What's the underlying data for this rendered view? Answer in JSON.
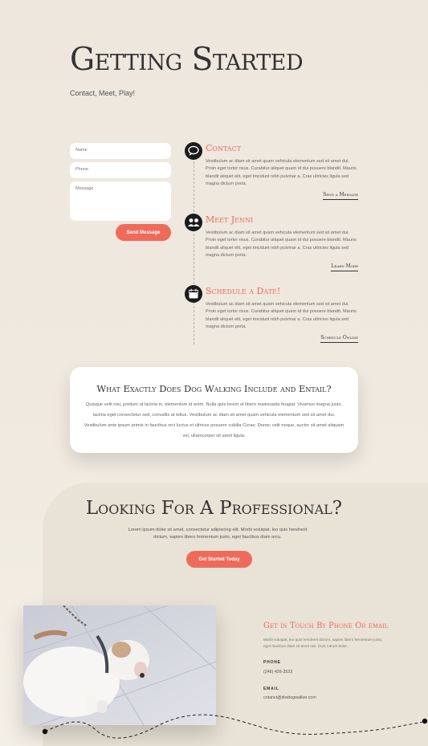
{
  "header": {
    "title": "Getting Started",
    "subtitle": "Contact, Meet, Play!"
  },
  "form": {
    "name_placeholder": "Name",
    "phone_placeholder": "Phone",
    "message_placeholder": "Message",
    "send_label": "Send Message"
  },
  "timeline": [
    {
      "title": "Contact",
      "icon": "chat-bubble-icon",
      "body": "Vestibulum ac diam sit amet quam vehicula elementum sed sit amet dui. Proin eget tortor risus. Curabitur aliquet quam id dui posuere blandit. Mauris blandit aliquet elit, eget tincidunt nibh pulvinar a. Cras ultricies ligula sed magna dictum porta.",
      "link": "Send a Message"
    },
    {
      "title": "Meet Jenni",
      "icon": "people-icon",
      "body": "Vestibulum ac diam sit amet quam vehicula elementum sed sit amet dui. Proin eget tortor risus. Curabitur aliquet quam id dui posuere blandit. Mauris blandit aliquet elit, eget tincidunt nibh pulvinar a. Cras ultricies ligula sed magna dictum porta.",
      "link": "Learn More"
    },
    {
      "title": "Schedule a Date!",
      "icon": "calendar-icon",
      "body": "Vestibulum ac diam sit amet quam vehicula elementum sed sit amet dui. Proin eget tortor risus. Curabitur aliquet quam id dui posuere blandit. Mauris blandit aliquet elit, eget tincidunt nibh pulvinar a. Cras ultricies ligula sed magna dictum porta.",
      "link": "Schedule Online"
    }
  ],
  "card": {
    "title": "What Exactly Does Dog Walking Include and Entail?",
    "body": "Quisque velit nisi, pretium ut lacinia in, elementum id enim. Nulla quis lorem ut libero malesuada feugiat. Vivamus magna justo, lacinia eget consectetur sed, convallis at tellus. Vestibulum ac diam sit amet quam vehicula elementum sed sit amet dui. Vestibulum ante ipsum primis in faucibus orci luctus et ultrices posuere cubilia Curae; Donec velit neque, auctor sit amet aliquam vel, ullamcorper sit amet ligula."
  },
  "professional": {
    "title": "Looking For A Professional?",
    "body": "Lorem ipsum dolor sit amet, consectetur adipiscing elit. Morbi volutpat, leo quis hendrerit dictum, sapien libero fermentum justo, eget faucibus diam arcu.",
    "cta_label": "Get Started Today"
  },
  "contact": {
    "heading": "Get in Touch By Phone Or email",
    "body": "Morbi volutpat, leo quis hendrerit dictum, sapien libero fermentum justo, eget faucibus diam sit amet nisi. Duis rutrum dolor.",
    "phone_label": "PHONE",
    "phone_value": "(246) 426-3523",
    "email_label": "EMAIL",
    "email_value": "cotanct@dividogwalker.com"
  },
  "colors": {
    "accent": "#ee6b5b",
    "background": "#ede7dd",
    "dark": "#333333"
  }
}
